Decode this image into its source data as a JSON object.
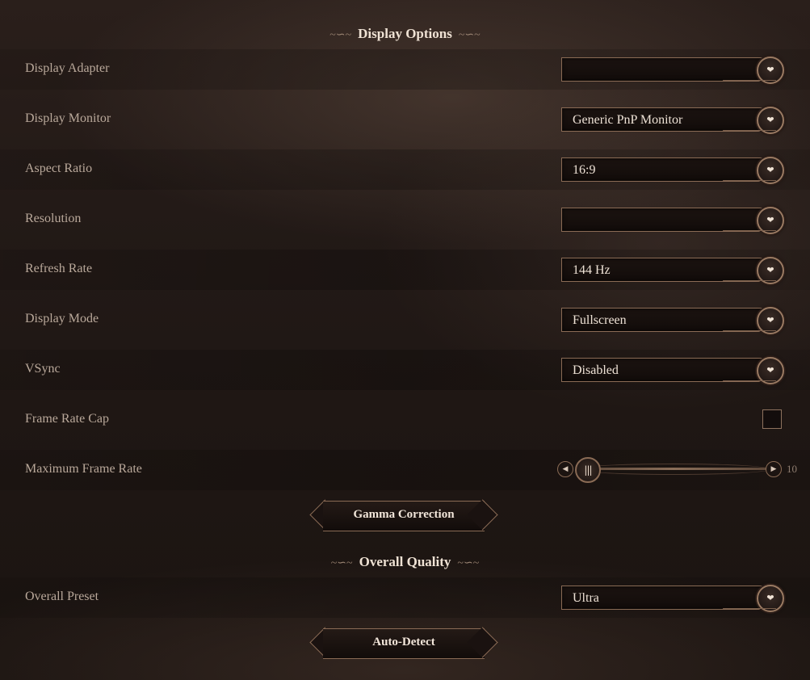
{
  "sections": {
    "display_title": "Display Options",
    "quality_title": "Overall Quality"
  },
  "rows": {
    "display_adapter": {
      "label": "Display Adapter",
      "value": ""
    },
    "display_monitor": {
      "label": "Display Monitor",
      "value": "Generic PnP Monitor"
    },
    "aspect_ratio": {
      "label": "Aspect Ratio",
      "value": "16:9"
    },
    "resolution": {
      "label": "Resolution",
      "value": ""
    },
    "refresh_rate": {
      "label": "Refresh Rate",
      "value": "144 Hz"
    },
    "display_mode": {
      "label": "Display Mode",
      "value": "Fullscreen"
    },
    "vsync": {
      "label": "VSync",
      "value": "Disabled"
    },
    "frame_rate_cap": {
      "label": "Frame Rate Cap",
      "checked": false
    },
    "max_frame_rate": {
      "label": "Maximum Frame Rate",
      "value": "10",
      "level": 0
    },
    "overall_preset": {
      "label": "Overall Preset",
      "value": "Ultra"
    }
  },
  "buttons": {
    "gamma": "Gamma Correction",
    "auto_detect": "Auto-Detect"
  },
  "icons": {
    "dropdown": "chevron-down-icon",
    "slider_left": "chevron-left-icon",
    "slider_right": "chevron-right-icon",
    "flourish": "ornament-flourish"
  },
  "colors": {
    "accent_border": "#8a6b55",
    "title_text": "#efe2d4",
    "label_text": "#b9a89a"
  }
}
